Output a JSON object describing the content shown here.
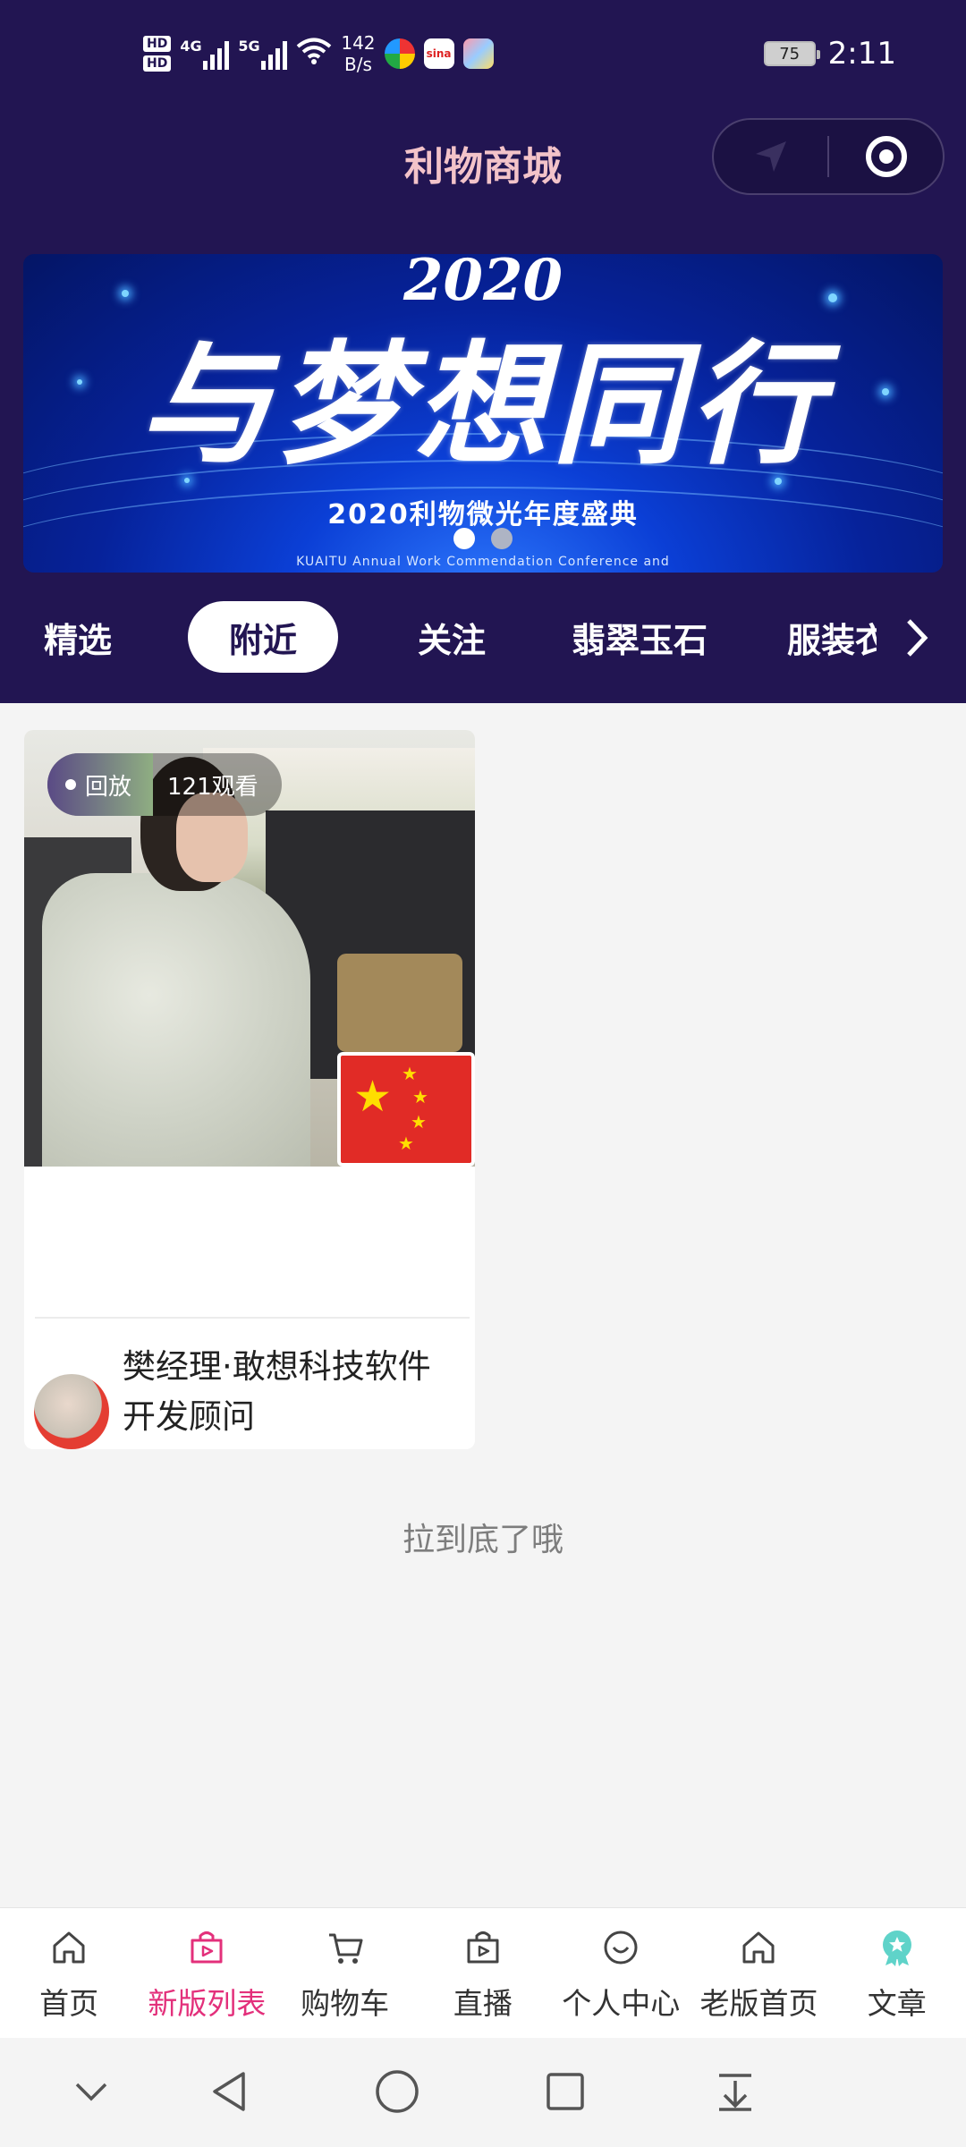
{
  "status_bar": {
    "hd1": "HD",
    "hd2": "HD",
    "gen1": "4G",
    "gen2": "5G",
    "speed_value": "142",
    "speed_unit": "B/s",
    "battery": "75",
    "time": "2:11"
  },
  "header": {
    "title": "利物商城"
  },
  "banner": {
    "year": "2020",
    "headline": "与梦想同行",
    "subtitle": "2020利物微光年度盛典",
    "english": "KUAITU Annual Work Commendation Conference and",
    "slide_count": 2,
    "active_slide": 1
  },
  "category_tabs": {
    "items": [
      "精选",
      "附近",
      "关注",
      "翡翠玉石",
      "服装衣"
    ],
    "active": "附近"
  },
  "live_card": {
    "status": "回放",
    "views": "121观看",
    "shop_name": "樊经理·敢想科技软件开发顾问"
  },
  "end_text": "拉到底了哦",
  "bottom_tabs": {
    "items": [
      "首页",
      "新版列表",
      "购物车",
      "直播",
      "个人中心",
      "老版首页",
      "文章"
    ],
    "active": "新版列表",
    "active_color": "#e3307b"
  },
  "colors": {
    "header_bg": "#221552",
    "title_color": "#f3c3c9"
  }
}
